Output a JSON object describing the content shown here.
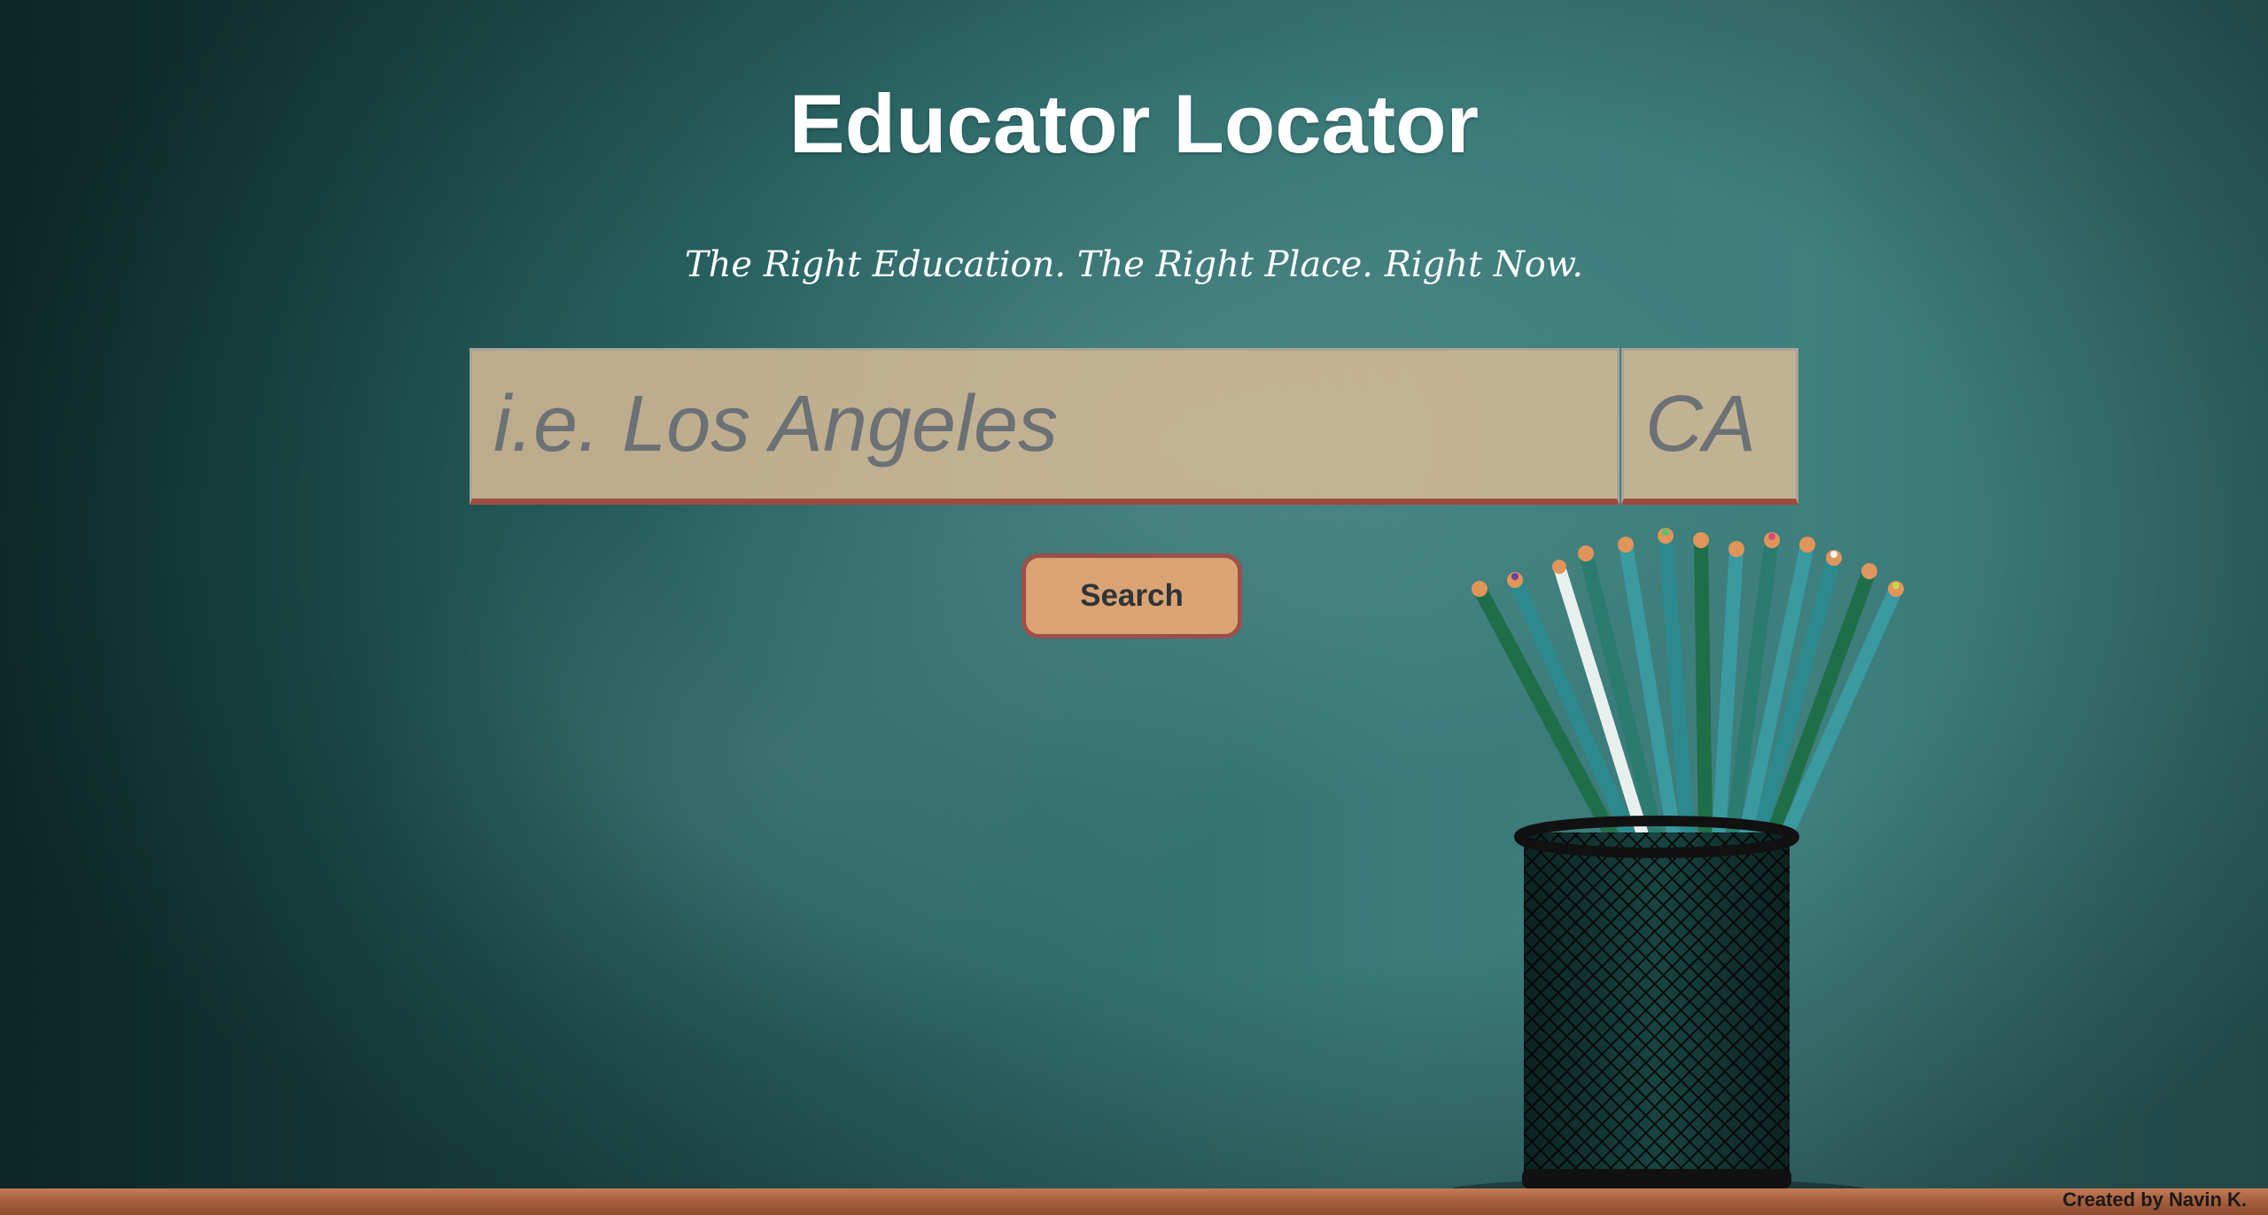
{
  "header": {
    "title": "Educator Locator",
    "tagline": "The Right Education. The Right Place. Right Now."
  },
  "search": {
    "city_placeholder": "i.e. Los Angeles",
    "city_value": "",
    "state_placeholder": "CA",
    "state_value": "",
    "button_label": "Search"
  },
  "footer": {
    "credit": "Created by Navin K."
  },
  "colors": {
    "input_background": "#d6ba96",
    "input_border_bottom": "#9c4b42",
    "button_background": "#d9a373",
    "button_border": "#9e4f49",
    "chalkboard": "#2c6767"
  }
}
